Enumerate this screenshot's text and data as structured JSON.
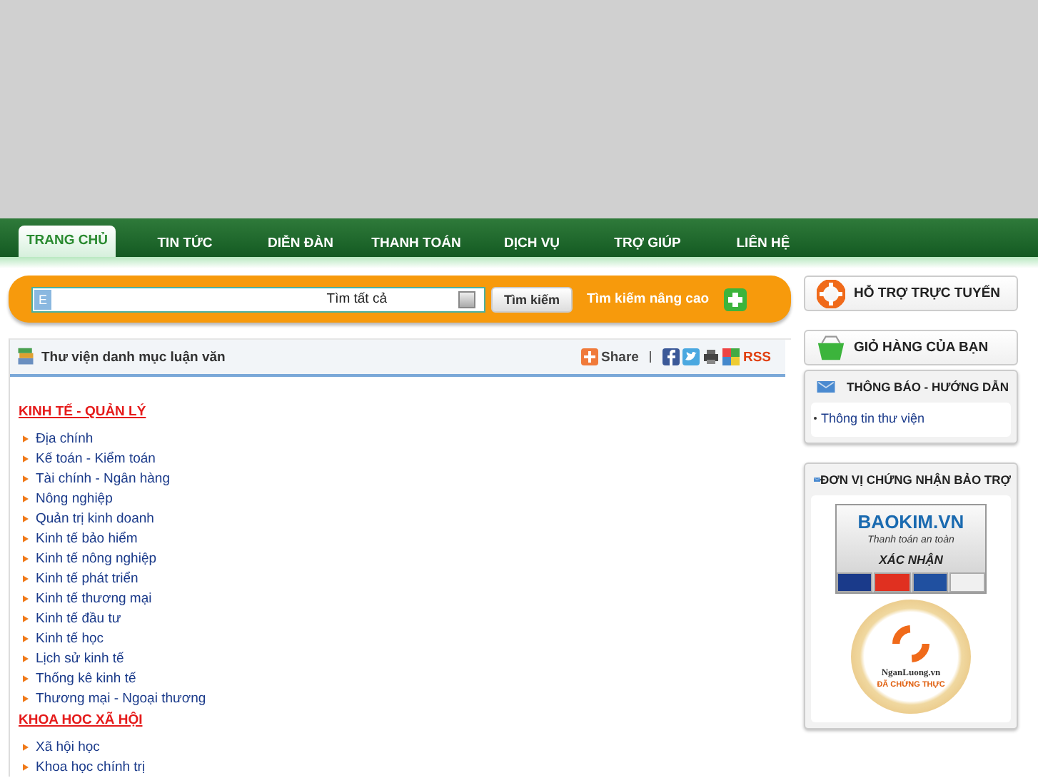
{
  "nav": {
    "tabs": [
      {
        "label": "TRANG CHỦ",
        "selected": true
      },
      {
        "label": "TIN TỨC",
        "selected": false
      },
      {
        "label": "DIỄN ĐÀN",
        "selected": false
      },
      {
        "label": "THANH TOÁN",
        "selected": false
      },
      {
        "label": "DỊCH VỤ",
        "selected": false
      },
      {
        "label": "TRỢ GIÚP",
        "selected": false
      },
      {
        "label": "LIÊN HỆ",
        "selected": false
      }
    ]
  },
  "search": {
    "badge": "E",
    "scope": "Tìm tất cả",
    "button": "Tìm kiếm",
    "advanced": "Tìm kiếm nâng cao"
  },
  "library": {
    "title": "Thư viện danh mục luận văn",
    "share": "Share",
    "rss": "RSS",
    "sections": [
      {
        "heading": "KINH TẾ - QUẢN LÝ",
        "items": [
          "Địa chính",
          "Kế toán - Kiểm toán",
          "Tài chính - Ngân hàng",
          "Nông nghiệp",
          "Quản trị kinh doanh",
          "Kinh tế bảo hiểm",
          "Kinh tế nông nghiệp",
          "Kinh tế phát triển",
          "Kinh tế thương mại",
          "Kinh tế đầu tư",
          "Kinh tế học",
          "Lịch sử kinh tế",
          "Thống kê kinh tế",
          "Thương mại - Ngoại thương"
        ]
      },
      {
        "heading": "KHOA HOC XÃ HỘI",
        "items": [
          "Xã hội học",
          "Khoa học chính trị"
        ]
      }
    ]
  },
  "sidebar": {
    "support": "HỖ TRỢ TRỰC TUYẾN",
    "cart": "GIỎ HÀNG CỦA BẠN",
    "notices": {
      "title": "THÔNG BÁO - HƯỚNG DẪN",
      "items": [
        "Thông tin thư viện"
      ]
    },
    "sponsors": {
      "title": "ĐƠN VỊ CHỨNG NHẬN BẢO TRỢ",
      "baokim": {
        "brand": "BAOKIM.VN",
        "tagline": "Thanh toán an toàn",
        "stamp": "XÁC NHẬN"
      },
      "nganluong": {
        "brand": "NganLuong.vn",
        "stamp": "ĐÃ CHỨNG THỰC"
      }
    }
  }
}
